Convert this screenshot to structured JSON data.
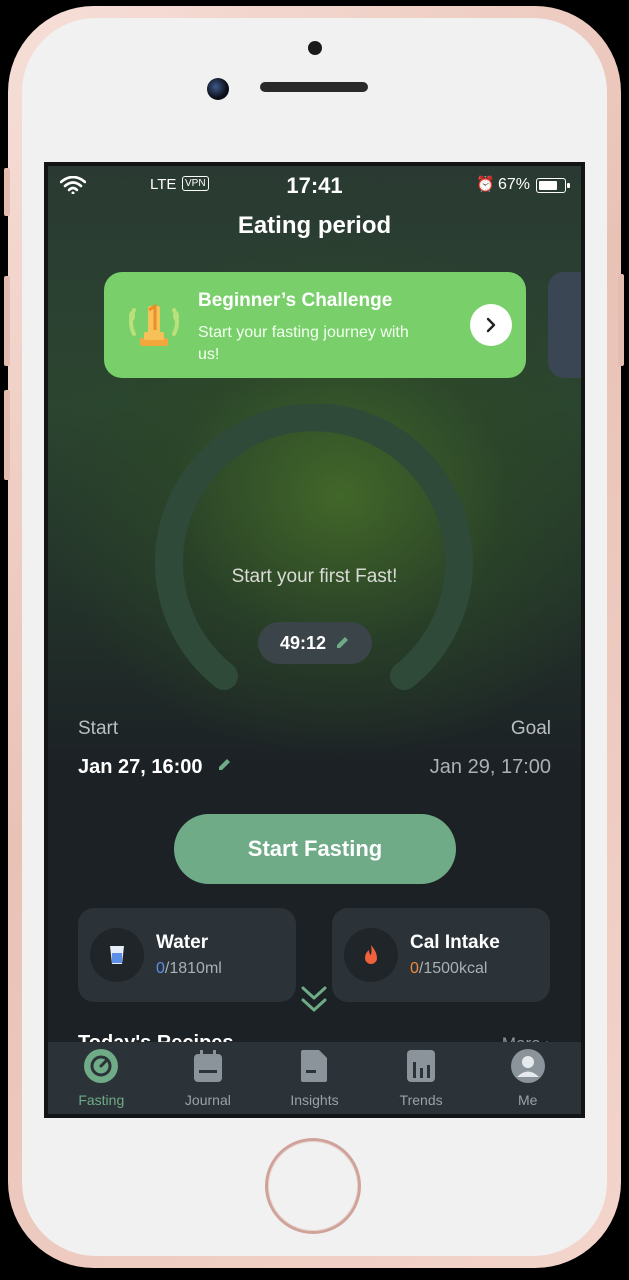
{
  "status_bar": {
    "carrier": "LTE",
    "vpn": "VPN",
    "time": "17:41",
    "battery": "67%"
  },
  "header": {
    "title": "Eating period"
  },
  "challenge": {
    "title": "Beginner’s Challenge",
    "subtitle": "Start your fasting journey with us!"
  },
  "timer": {
    "prompt": "Start your first Fast!",
    "duration": "49:12"
  },
  "schedule": {
    "start_label": "Start",
    "start_value": "Jan 27, 16:00",
    "goal_label": "Goal",
    "goal_value": "Jan 29, 17:00"
  },
  "primary_action": {
    "label": "Start Fasting"
  },
  "cards": [
    {
      "title": "Water",
      "current": "0",
      "target": "/1810ml",
      "accent": "#5b8fe8"
    },
    {
      "title": "Cal Intake",
      "current": "0",
      "target": "/1500kcal",
      "accent": "#f08a3c"
    }
  ],
  "recipes": {
    "title": "Today's Recipes",
    "more": "More"
  },
  "tabs": [
    {
      "label": "Fasting",
      "icon": "fasting-icon",
      "active": true
    },
    {
      "label": "Journal",
      "icon": "journal-icon",
      "active": false
    },
    {
      "label": "Insights",
      "icon": "insights-icon",
      "active": false
    },
    {
      "label": "Trends",
      "icon": "trends-icon",
      "active": false
    },
    {
      "label": "Me",
      "icon": "me-icon",
      "active": false
    }
  ],
  "colors": {
    "accent_green": "#6eab86",
    "challenge_green": "#79d06a",
    "background": "#1c2125"
  }
}
